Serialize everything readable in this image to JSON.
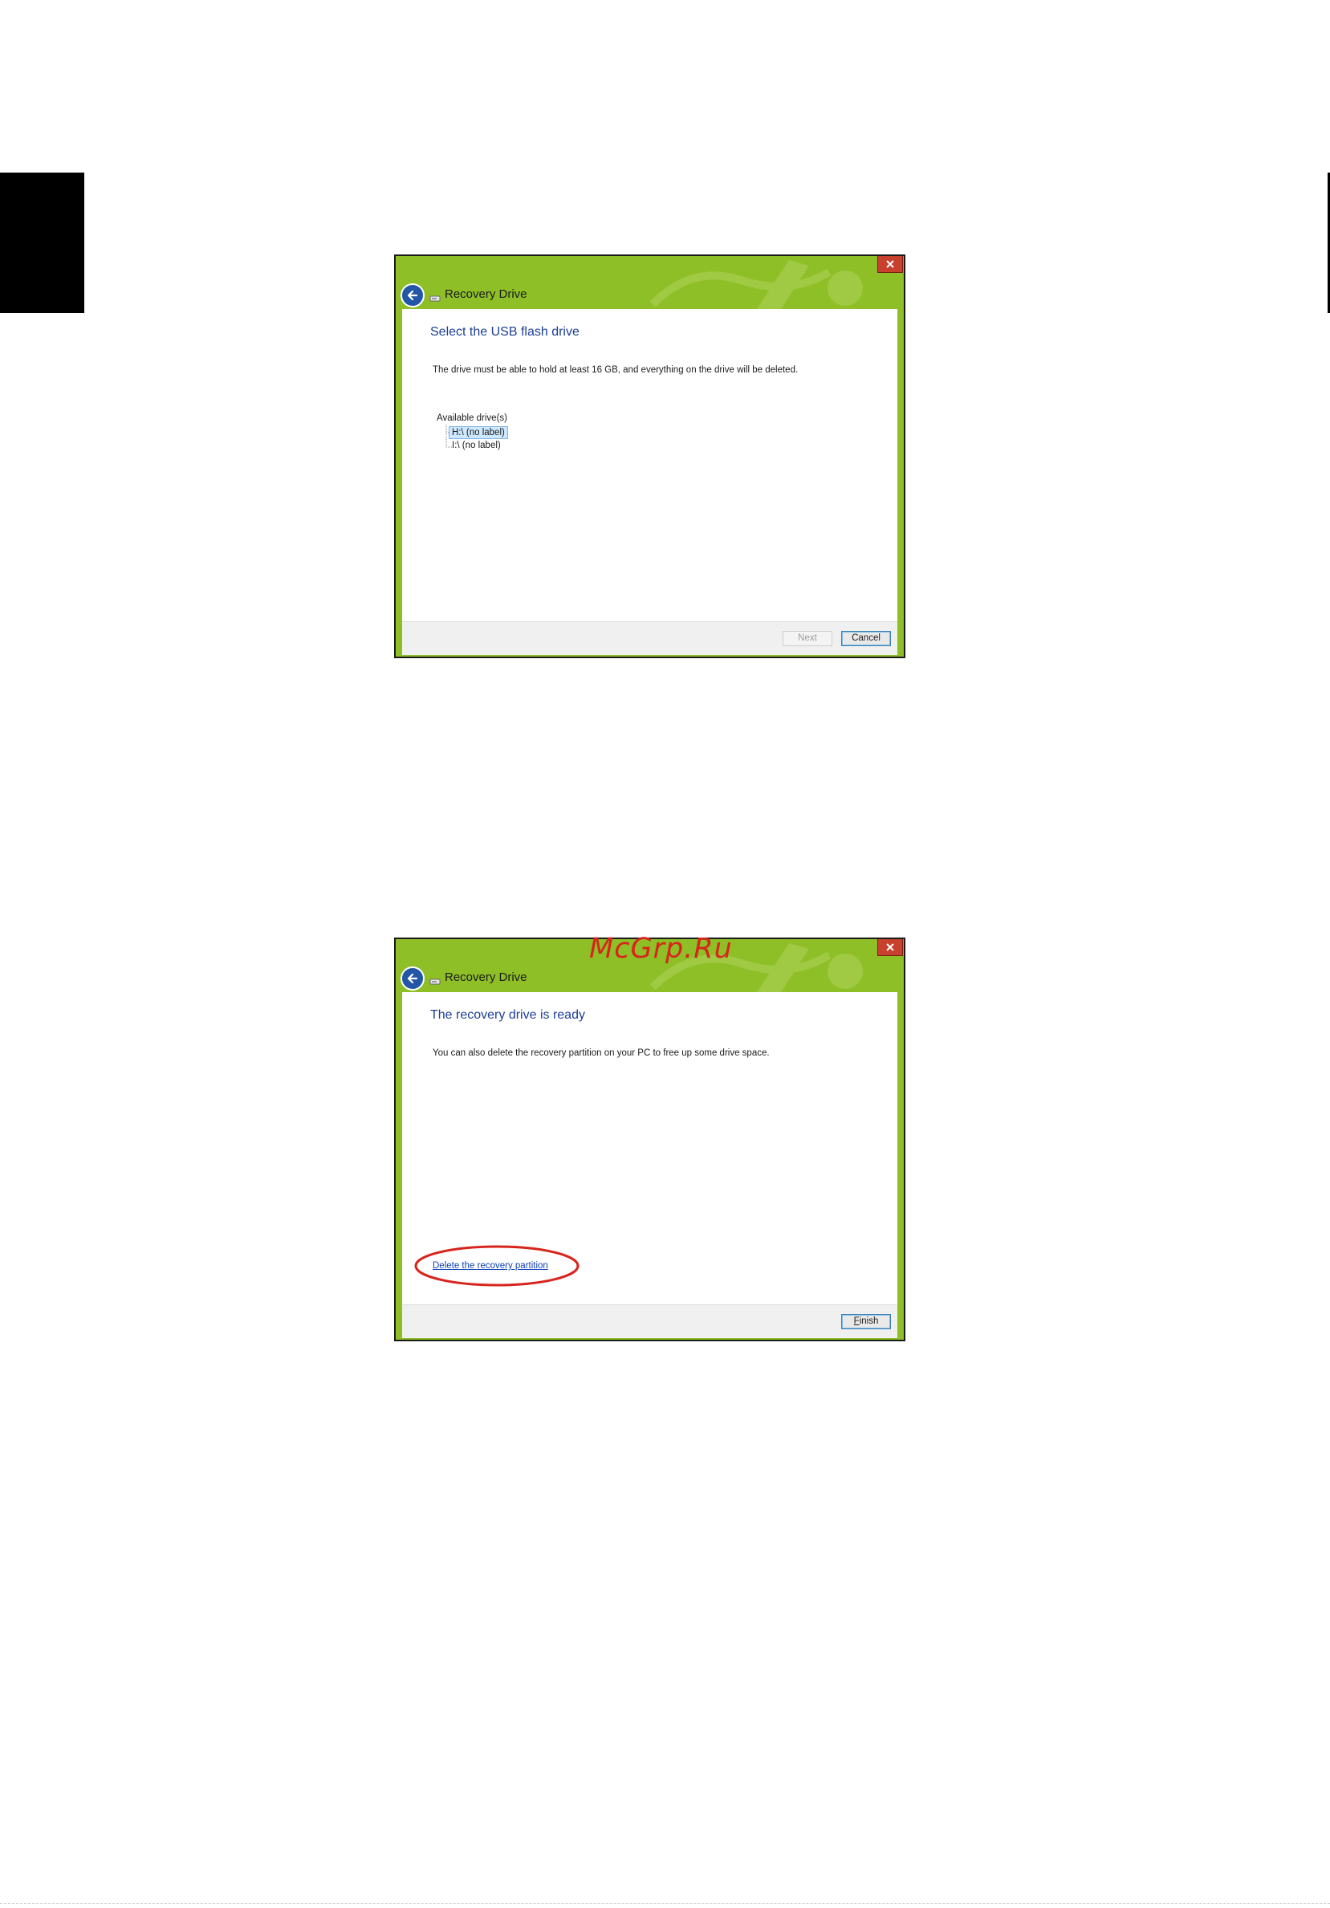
{
  "colors": {
    "dialog_frame": "#8ebf26",
    "heading_blue": "#1d3f96",
    "link_blue": "#0f42b8",
    "close_red": "#c8402e",
    "annotation_red": "#d8241c"
  },
  "watermark": "McGrp.Ru",
  "dialog_select": {
    "title": "Recovery Drive",
    "heading": "Select the USB flash drive",
    "body": "The drive must be able to hold at least 16 GB, and everything on the drive will be deleted.",
    "tree_label": "Available drive(s)",
    "drives": [
      {
        "label": "H:\\ (no label)",
        "selected": true
      },
      {
        "label": "I:\\ (no label)",
        "selected": false
      }
    ],
    "buttons": {
      "next": "Next",
      "next_disabled": true,
      "cancel": "Cancel"
    },
    "icons": [
      "close-icon",
      "back-arrow-icon",
      "usb-drive-icon"
    ]
  },
  "dialog_ready": {
    "title": "Recovery Drive",
    "heading": "The recovery drive is ready",
    "body": "You can also delete the recovery partition on your PC to free up some drive space.",
    "link": "Delete the recovery partition",
    "buttons": {
      "finish_accel": "F",
      "finish_rest": "inish"
    },
    "icons": [
      "close-icon",
      "back-arrow-icon",
      "usb-drive-icon"
    ]
  }
}
